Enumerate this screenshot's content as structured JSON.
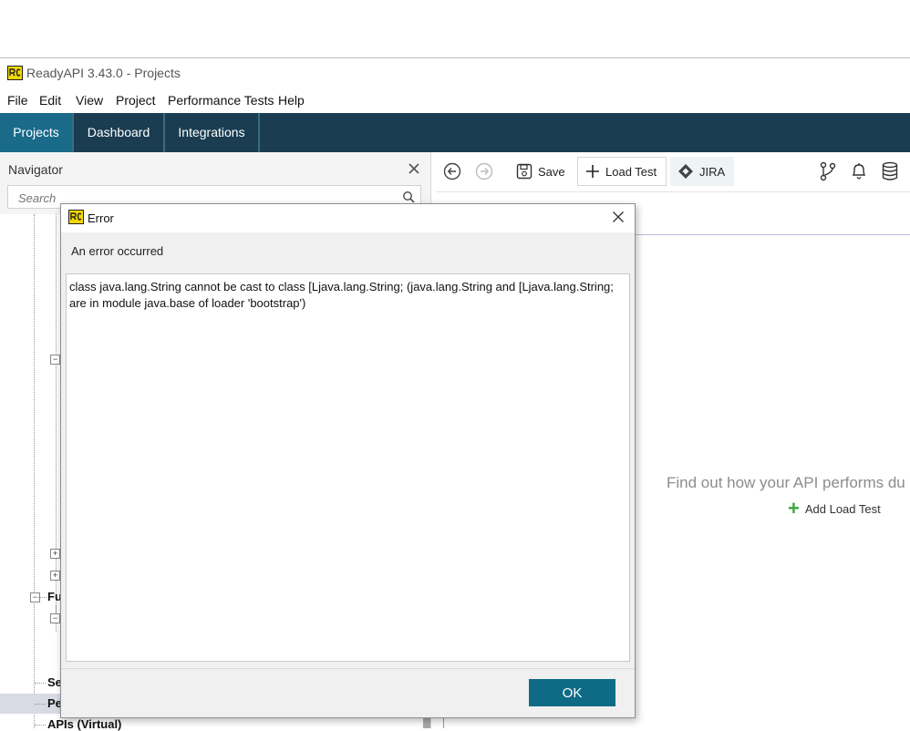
{
  "window": {
    "title": "ReadyAPI 3.43.0 - Projects",
    "logo_icon": "readyapi-logo-icon"
  },
  "menu": [
    "File",
    "Edit",
    "View",
    "Project",
    "Performance Tests",
    "Help"
  ],
  "nav_tabs": [
    {
      "label": "Projects",
      "active": true
    },
    {
      "label": "Dashboard",
      "active": false
    },
    {
      "label": "Integrations",
      "active": false
    }
  ],
  "navigator": {
    "title": "Navigator",
    "search_placeholder": "Search",
    "tree_labels": {
      "fu": "Fu",
      "se": "Se",
      "pe": "Pe",
      "apis": "APIs (Virtual)"
    }
  },
  "toolbar": {
    "save_label": "Save",
    "load_test_label": "Load Test",
    "jira_label": "JIRA"
  },
  "workspace": {
    "empty_text": "Find out how your API performs du",
    "add_load_test_label": "Add Load Test"
  },
  "dialog": {
    "title": "Error",
    "message": "An error occurred",
    "details": "class java.lang.String cannot be cast to class [Ljava.lang.String; (java.lang.String and [Ljava.lang.String; are in module java.base of loader 'bootstrap')",
    "ok_label": "OK"
  },
  "colors": {
    "nav_bg": "#1a3d52",
    "nav_active": "#1a6a8a",
    "ok_button": "#0f6b85",
    "add_icon": "#3aa83a"
  }
}
